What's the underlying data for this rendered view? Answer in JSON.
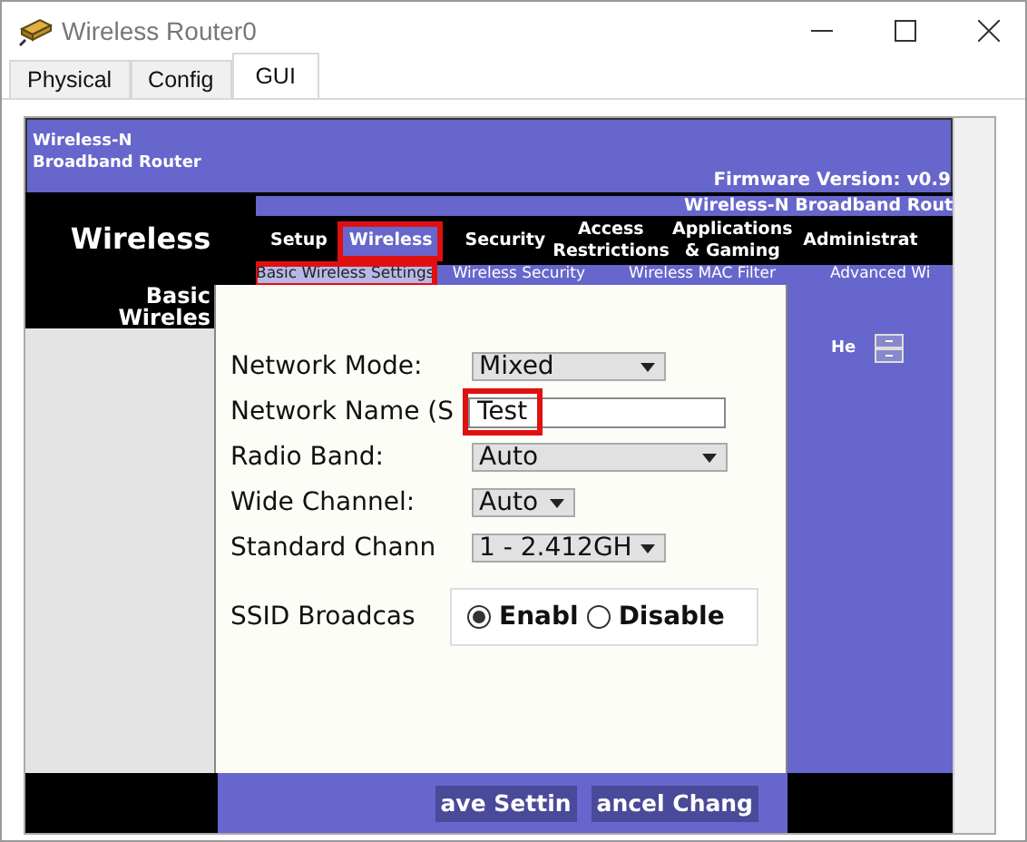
{
  "window": {
    "title": "Wireless Router0"
  },
  "tabs": [
    {
      "label": "Physical",
      "selected": false
    },
    {
      "label": "Config",
      "selected": false
    },
    {
      "label": "GUI",
      "selected": true
    }
  ],
  "router": {
    "brand_lines": [
      "Wireless-N",
      "Broadband Router"
    ],
    "firmware": "Firmware Version: v0.9",
    "section_title": "Wireless",
    "product_name": "Wireless-N Broadband Rout",
    "nav": [
      {
        "label": "Setup",
        "selected": false,
        "highlighted": false
      },
      {
        "label": "Wireless",
        "selected": true,
        "highlighted": true
      },
      {
        "label": "Security",
        "selected": false,
        "highlighted": false
      },
      {
        "label": "Access Restrictions",
        "selected": false,
        "highlighted": false
      },
      {
        "label": "Applications & Gaming",
        "selected": false,
        "highlighted": false
      },
      {
        "label": "Administrat",
        "selected": false,
        "highlighted": false
      }
    ],
    "subnav": [
      {
        "label": "Basic Wireless Settings",
        "selected": true,
        "highlighted": true
      },
      {
        "label": "Wireless Security",
        "selected": false,
        "highlighted": false
      },
      {
        "label": "Wireless MAC Filter",
        "selected": false,
        "highlighted": false
      },
      {
        "label": "Advanced Wi",
        "selected": false,
        "highlighted": false
      }
    ],
    "page_title": [
      "Basic",
      "Wireles"
    ],
    "form": [
      {
        "kind": "select",
        "label": "Network Mode:",
        "value": "Mixed"
      },
      {
        "kind": "input",
        "label": "Network Name (S",
        "value": "Test",
        "highlighted": true
      },
      {
        "kind": "select",
        "label": "Radio Band:",
        "value": "Auto"
      },
      {
        "kind": "select",
        "label": "Wide Channel:",
        "value": "Auto"
      },
      {
        "kind": "select",
        "label": "Standard Chann",
        "value": "1 - 2.412GH"
      }
    ],
    "ssid": {
      "label": "SSID Broadcas",
      "options": [
        {
          "label": "Enabl",
          "selected": true
        },
        {
          "label": "Disable",
          "selected": false
        }
      ]
    },
    "help": "He",
    "buttons": [
      "ave Settin",
      "ancel Chang"
    ]
  }
}
